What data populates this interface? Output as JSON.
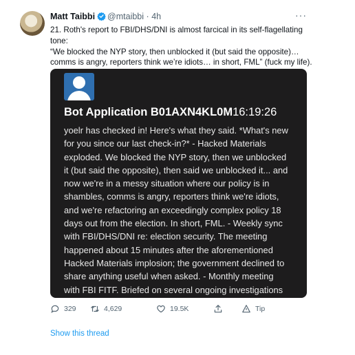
{
  "author": {
    "name": "Matt Taibbi",
    "handle": "@mtaibbi",
    "separator": "·",
    "time": "4h"
  },
  "tweet": {
    "lines": [
      "21.  Roth's report to FBI/DHS/DNI is almost farcical in its self-flagellating",
      "tone:",
      "“We blocked the NYP story, then unblocked it (but said the opposite)…",
      "comms is angry, reporters think we’re idiots… in short, FML” (fuck my life)."
    ],
    "more_label": "···"
  },
  "card": {
    "app_name": "Bot Application B01AXN4KL0M",
    "timestamp": "16:19:26",
    "lines": [
      "yoelr has checked in! Here's what they said. *What's new",
      "for you since our last check-in?* - Hacked Materials",
      "exploded. We blocked the NYP story, then we unblocked",
      "it (but said the opposite), then said we unblocked it... and",
      "now we're in a messy situation where our policy is in",
      "shambles, comms is angry, reporters think we're idiots,",
      "and we're refactoring an exceedingly complex policy 18",
      "days out from the election. In short, FML. - Weekly sync",
      "with FBI/DHS/DNI re: election security. The meeting",
      "happened about 15 minutes after the aforementioned",
      "Hacked Materials implosion; the government declined to",
      "share anything useful when asked. - Monthly meeting",
      "with FBI FITF. Briefed on several ongoing investigations"
    ]
  },
  "actions": {
    "replies": "329",
    "retweets": "4,629",
    "likes": "19.5K",
    "tip_label": "Tip"
  },
  "show_thread_label": "Show this thread",
  "colors": {
    "link": "#1d9bf0",
    "verified": "#1d9bf0",
    "card_bg": "#1d1c1d"
  }
}
